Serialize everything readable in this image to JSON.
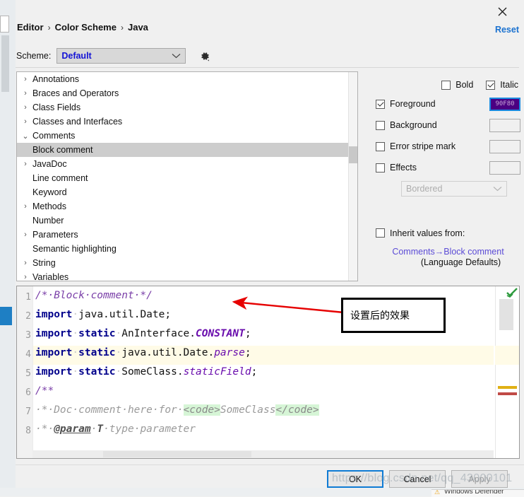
{
  "window": {
    "close_icon": "close-icon",
    "reset_label": "Reset"
  },
  "breadcrumb": {
    "items": [
      "Editor",
      "Color Scheme",
      "Java"
    ],
    "separator": "›"
  },
  "scheme": {
    "label": "Scheme:",
    "value": "Default",
    "chevron": "∨",
    "gear_icon": "gear-icon"
  },
  "tree": {
    "items": [
      {
        "label": "Annotations",
        "depth": 0,
        "twisty": "collapsed",
        "selected": false
      },
      {
        "label": "Braces and Operators",
        "depth": 0,
        "twisty": "collapsed",
        "selected": false
      },
      {
        "label": "Class Fields",
        "depth": 0,
        "twisty": "collapsed",
        "selected": false
      },
      {
        "label": "Classes and Interfaces",
        "depth": 0,
        "twisty": "collapsed",
        "selected": false
      },
      {
        "label": "Comments",
        "depth": 0,
        "twisty": "expanded",
        "selected": false
      },
      {
        "label": "Block comment",
        "depth": 1,
        "twisty": "none",
        "selected": true
      },
      {
        "label": "JavaDoc",
        "depth": 1,
        "twisty": "collapsed",
        "selected": false
      },
      {
        "label": "Line comment",
        "depth": 1,
        "twisty": "none",
        "selected": false
      },
      {
        "label": "Keyword",
        "depth": 0,
        "twisty": "none",
        "selected": false
      },
      {
        "label": "Methods",
        "depth": 0,
        "twisty": "collapsed",
        "selected": false
      },
      {
        "label": "Number",
        "depth": 0,
        "twisty": "none",
        "selected": false
      },
      {
        "label": "Parameters",
        "depth": 0,
        "twisty": "collapsed",
        "selected": false
      },
      {
        "label": "Semantic highlighting",
        "depth": 0,
        "twisty": "none",
        "selected": false
      },
      {
        "label": "String",
        "depth": 0,
        "twisty": "collapsed",
        "selected": false
      },
      {
        "label": "Variables",
        "depth": 0,
        "twisty": "collapsed",
        "selected": false
      }
    ]
  },
  "options": {
    "bold": {
      "label": "Bold",
      "checked": false
    },
    "italic": {
      "label": "Italic",
      "checked": true
    },
    "foreground": {
      "label": "Foreground",
      "checked": true,
      "swatch_text": "90F80",
      "swatch_color": "#4b0082",
      "swatch_focus": "#1b8ae0"
    },
    "background": {
      "label": "Background",
      "checked": false,
      "swatch_text": "",
      "swatch_color": "#f0f0f0"
    },
    "error_stripe": {
      "label": "Error stripe mark",
      "checked": false,
      "swatch_text": "",
      "swatch_color": "#f0f0f0"
    },
    "effects": {
      "label": "Effects",
      "checked": false,
      "swatch_text": "",
      "swatch_color": "#f0f0f0",
      "combo_value": "Bordered",
      "combo_chevron": "∨"
    },
    "inherit": {
      "label": "Inherit values from:",
      "checked": false,
      "link": "Comments→Block comment",
      "sublabel": "(Language Defaults)"
    }
  },
  "preview": {
    "lines": [
      "1",
      "2",
      "3",
      "4",
      "5",
      "6",
      "7",
      "8"
    ],
    "highlighted_line": 4,
    "code": [
      "/* Block comment */",
      "import java.util.Date;",
      "import static AnInterface.CONSTANT;",
      "import static java.util.Date.parse;",
      "import static SomeClass.staticField;",
      "/**",
      " * Doc comment here for <code>SomeClass</code>",
      " * @param T type parameter"
    ],
    "stripe_check_icon": "inspection-ok-icon"
  },
  "annotation": {
    "text": "设置后的效果",
    "arrow_color": "#e60000"
  },
  "footer": {
    "ok": "OK",
    "cancel": "Cancel",
    "apply": "Apply",
    "apply_disabled": true
  },
  "watermark": {
    "text": "https://blog.csdn.net/qq_43000101"
  },
  "toast": {
    "text": "Windows Defender",
    "icon": "shield-warning-icon"
  }
}
